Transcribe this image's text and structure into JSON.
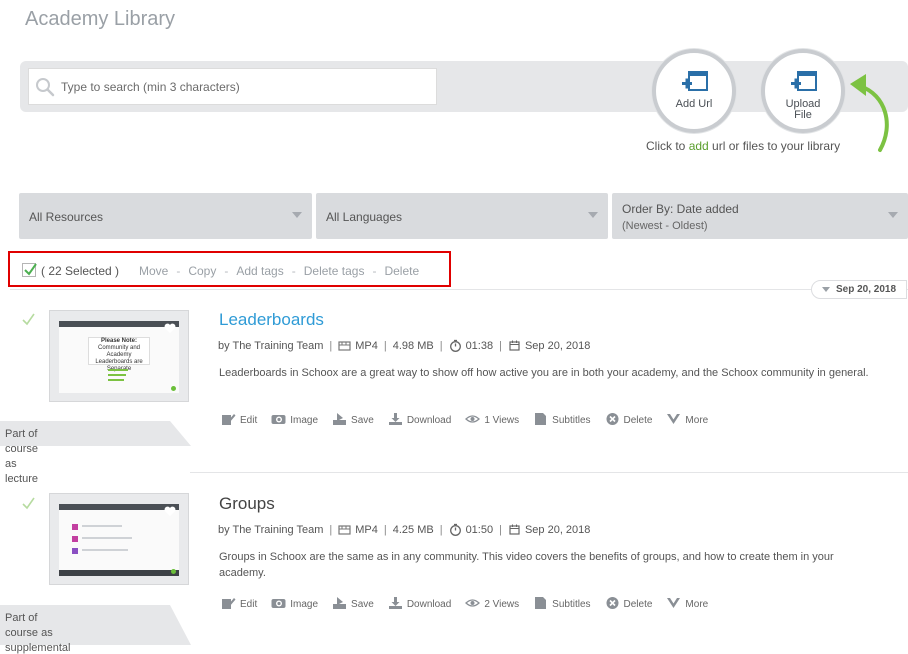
{
  "page": {
    "title": "Academy Library"
  },
  "search": {
    "placeholder": "Type to search (min 3 characters)"
  },
  "add_buttons": {
    "add_url": "Add Url",
    "upload_line1": "Upload",
    "upload_line2": "File"
  },
  "hint": {
    "prefix": "Click to ",
    "add_word": "add",
    "suffix": " url or files to your library"
  },
  "filters": {
    "resources": "All Resources",
    "languages": "All Languages",
    "order_label": "Order By: Date added",
    "order_sub": "(Newest - Oldest)"
  },
  "bulk": {
    "count": "( 22 Selected )",
    "actions": [
      "Move",
      "Copy",
      "Add tags",
      "Delete tags",
      "Delete"
    ],
    "separator": "-"
  },
  "date_tag": "Sep 20, 2018",
  "items": [
    {
      "title": "Leaderboards",
      "author": "by The Training Team",
      "format": "MP4",
      "size": "4.98 MB",
      "duration": "01:38",
      "date": "Sep 20, 2018",
      "description": "Leaderboards in Schoox are a great way to show off how active you are in both your academy, and the Schoox community in general.",
      "actions": {
        "edit": "Edit",
        "image": "Image",
        "save": "Save",
        "download": "Download",
        "views": "1 Views",
        "subtitles": "Subtitles",
        "delete": "Delete",
        "more": "More"
      },
      "banner": {
        "line1": "Part of course as lecture",
        "line2": ""
      },
      "thumb_text": {
        "heading": "Please Note:",
        "body": "Community and Academy Leaderboards are Separate"
      }
    },
    {
      "title": "Groups",
      "author": "by The Training Team",
      "format": "MP4",
      "size": "4.25 MB",
      "duration": "01:50",
      "date": "Sep 20, 2018",
      "description": "Groups in Schoox are the same as in any community. This video covers the benefits of groups, and how to create them in your academy.",
      "actions": {
        "edit": "Edit",
        "image": "Image",
        "save": "Save",
        "download": "Download",
        "views": "2 Views",
        "subtitles": "Subtitles",
        "delete": "Delete",
        "more": "More"
      },
      "banner": {
        "line1": "Part of course as",
        "line2": "supplemental material"
      }
    }
  ],
  "colors": {
    "link": "#2f9bd6",
    "accent_green": "#5a9e2c",
    "highlight_border": "#e00000"
  },
  "icons": [
    "search-icon",
    "add-url-icon",
    "upload-file-icon",
    "curved-arrow-icon",
    "checkmark-icon",
    "film-icon",
    "stopwatch-icon",
    "calendar-icon",
    "edit-icon",
    "image-icon",
    "save-icon",
    "download-icon",
    "eye-icon",
    "subtitles-icon",
    "delete-icon",
    "chevron-down-icon",
    "heart-icon"
  ]
}
